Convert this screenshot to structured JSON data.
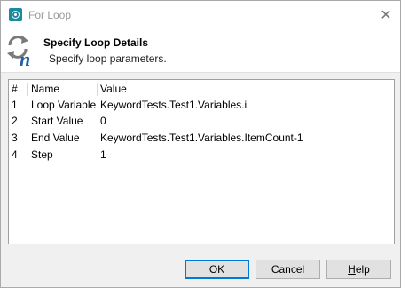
{
  "window": {
    "title": "For Loop",
    "close_glyph": "✕"
  },
  "header": {
    "icon": "loop-n-icon",
    "title": "Specify Loop Details",
    "subtitle": "Specify loop parameters."
  },
  "grid": {
    "columns": [
      "#",
      "Name",
      "Value"
    ],
    "rows": [
      {
        "num": "1",
        "name": "Loop Variable",
        "value": "KeywordTests.Test1.Variables.i"
      },
      {
        "num": "2",
        "name": "Start Value",
        "value": "0"
      },
      {
        "num": "3",
        "name": "End Value",
        "value": "KeywordTests.Test1.Variables.ItemCount-1"
      },
      {
        "num": "4",
        "name": "Step",
        "value": "1"
      }
    ]
  },
  "buttons": {
    "ok": "OK",
    "cancel": "Cancel",
    "help_mnemonic": "H",
    "help_rest": "elp"
  },
  "colors": {
    "accent": "#0078d7",
    "app_icon": "#1b8a9c",
    "loop_icon_blue": "#1f5fa8",
    "loop_icon_gray": "#7a7a7a"
  }
}
